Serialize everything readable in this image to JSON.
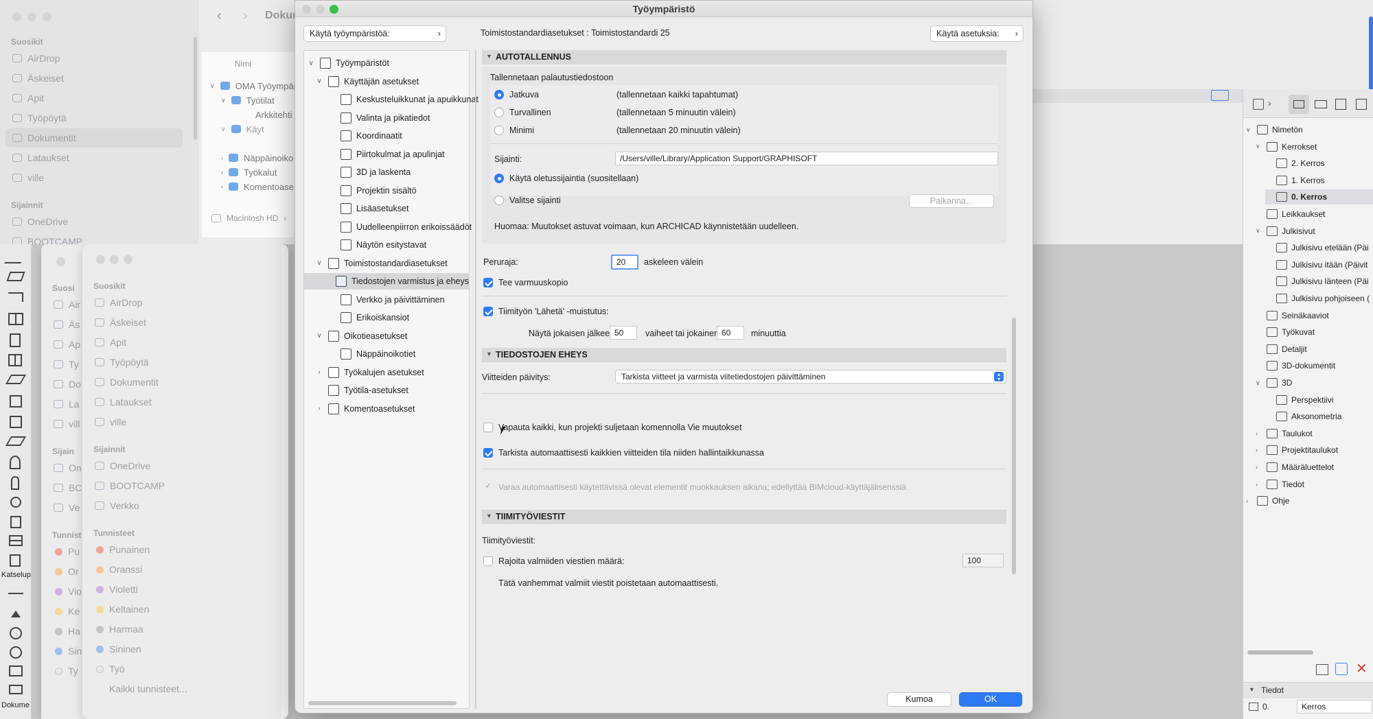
{
  "dialog": {
    "title": "Työympäristö",
    "top_left_button": "Käytä työympäristöä:",
    "breadcrumb": "Toimistostandardiasetukset : Toimistostandardi 25",
    "top_right_button": "Käytä asetuksia:",
    "cancel_label": "Kumoa",
    "ok_label": "OK"
  },
  "tree": [
    {
      "label": "Työympäristöt",
      "icon": "profile-icon"
    },
    {
      "label": "Käyttäjän asetukset",
      "icon": "user-settings-icon"
    },
    {
      "label": "Keskusteluikkunat ja apuikkunat",
      "icon": "dialogs-icon"
    },
    {
      "label": "Valinta ja pikatiedot",
      "icon": "selection-icon"
    },
    {
      "label": "Koordinaatit",
      "icon": "coordinates-icon"
    },
    {
      "label": "Piirtokulmat ja apulinjat",
      "icon": "snap-icon"
    },
    {
      "label": "3D ja laskenta",
      "icon": "3d-icon"
    },
    {
      "label": "Projektin sisältö",
      "icon": "project-icon"
    },
    {
      "label": "Lisäasetukset",
      "icon": "sliders-icon"
    },
    {
      "label": "Uudelleenpiirron erikoissäädöt",
      "icon": "redraw-icon"
    },
    {
      "label": "Näytön esitystavat",
      "icon": "display-icon"
    },
    {
      "label": "Toimistostandardiasetukset",
      "icon": "company-icon"
    },
    {
      "label": "Tiedostojen varmistus ja eheys",
      "icon": "file-safety-icon"
    },
    {
      "label": "Verkko ja päivittäminen",
      "icon": "network-icon"
    },
    {
      "label": "Erikoiskansiot",
      "icon": "folders-icon"
    },
    {
      "label": "Oikotieasetukset",
      "icon": "shortcut-icon"
    },
    {
      "label": "Näppäinoikotiet",
      "icon": "keyboard-icon"
    },
    {
      "label": "Työkalujen asetukset",
      "icon": "tools-icon"
    },
    {
      "label": "Työtila-asetukset",
      "icon": "workspace-icon"
    },
    {
      "label": "Komentoasetukset",
      "icon": "commands-icon"
    }
  ],
  "panel": {
    "autosave": {
      "header": "AUTOTALLENNUS",
      "group_label": "Tallennetaan palautustiedostoon",
      "options": [
        {
          "label": "Jatkuva",
          "desc": "(tallennetaan kaikki tapahtumat)",
          "selected": true
        },
        {
          "label": "Turvallinen",
          "desc": "(tallennetaan 5 minuutin välein)",
          "selected": false
        },
        {
          "label": "Minimi",
          "desc": "(tallennetaan 20 minuutin välein)",
          "selected": false
        }
      ],
      "location_label": "Sijainti:",
      "location_value": "/Users/ville/Library/Application Support/GRAPHISOFT",
      "default_location": "Käytä oletussijaintia (suositellaan)",
      "choose_location": "Valitse sijainti",
      "browse_button": "Paikanna...",
      "note": "Huomaa: Muutokset astuvat voimaan, kun ARCHICAD käynnistetään uudelleen."
    },
    "undo_label": "Peruraja:",
    "undo_value": "20",
    "undo_suffix": "askeleen välein",
    "backup_label": "Tee varmuuskopio",
    "teamwork_send_label": "Tiimityön 'Lähetä' -muistutus:",
    "reminder_prefix": "Näytä jokaisen jälkeen",
    "reminder_steps": "50",
    "reminder_middle": "vaiheet tai jokainen",
    "reminder_minutes": "60",
    "reminder_suffix": "minuuttia",
    "integrity": {
      "header": "TIEDOSTOJEN EHEYS",
      "refs_label": "Viitteiden päivitys:",
      "refs_value": "Tarkista viitteet ja varmista viitetiedostojen päivittäminen",
      "release_all": "Vapauta kaikki, kun projekti suljetaan komennolla Vie muutokset",
      "auto_check": "Tarkista automaattisesti kaikkien viitteiden tila niiden hallintaikkunassa",
      "reserve_auto": "Varaa automaattisesti käytettävissä olevat elementit muokkauksen aikana; edellyttää BIMcloud-käyttäjälisenssiä"
    },
    "teamwork_messages": {
      "header": "TIIMITYÖVIESTIT",
      "label": "Tiimityöviestit:",
      "limit_label": "Rajoita valmiiden viestien määrä:",
      "limit_value": "100",
      "note": "Tätä vanhemmat valmiit viestit poistetaan automaattisesti."
    }
  },
  "finder_back": {
    "title": "Dokum",
    "column_header": "Nimi",
    "favorites_header": "Suosikit",
    "favorites": [
      "AirDrop",
      "Äskeiset",
      "Apit",
      "Työpöytä",
      "Dokumentit",
      "Lataukset",
      "ville"
    ],
    "locations_header": "Sijainnit",
    "locations": [
      "OneDrive",
      "BOOTCAMP"
    ],
    "files": [
      "OMA Työympär",
      "Työtilat",
      "Arkkitehti",
      "Käyt",
      "Näppäinoiko",
      "Työkalut",
      "Komentoase"
    ],
    "path": [
      "Macintosh HD"
    ]
  },
  "finder_front": {
    "favorites_header": "Suosikit",
    "favorites": [
      "AirDrop",
      "Äskeiset",
      "Apit",
      "Työpöytä",
      "Dokumentit",
      "Lataukset",
      "ville"
    ],
    "locations_header": "Sijainnit",
    "locations": [
      "OneDrive",
      "BOOTCAMP",
      "Verkko"
    ],
    "tags_header": "Tunnisteet",
    "tags": [
      {
        "label": "Punainen",
        "color": "#f2a49c"
      },
      {
        "label": "Oranssi",
        "color": "#f5c79a"
      },
      {
        "label": "Violetti",
        "color": "#cfb1e0"
      },
      {
        "label": "Keltainen",
        "color": "#f2dc9a"
      },
      {
        "label": "Harmaa",
        "color": "#c4c4c7"
      },
      {
        "label": "Sininen",
        "color": "#9fc0ef"
      },
      {
        "label": "Työ",
        "color": "#e8e8ea"
      },
      {
        "label": "Kaikki tunnisteet...",
        "color": ""
      }
    ]
  },
  "finder_left": {
    "favorites_header": "Suosi",
    "favorites": [
      "Air",
      "Äs",
      "Ap",
      "Ty",
      "Do",
      "La",
      "vill"
    ],
    "locations_header": "Sijain",
    "locations": [
      "On",
      "BC",
      "Ve"
    ],
    "tags_header": "Tunnist",
    "tags": [
      "Pu",
      "Or",
      "Vio",
      "Ke",
      "Ha",
      "Sin",
      "Ty"
    ]
  },
  "toolbox": {
    "view_label": "Katselup",
    "doc_label": "Dokume"
  },
  "navigator": {
    "items": [
      {
        "label": "Nimetön",
        "icon": "project-icon",
        "level": 0,
        "twisty": "open"
      },
      {
        "label": "Kerrokset",
        "icon": "stories-icon",
        "level": 1,
        "twisty": "open"
      },
      {
        "label": "2. Kerros",
        "icon": "story-icon",
        "level": 2,
        "twisty": ""
      },
      {
        "label": "1. Kerros",
        "icon": "story-icon",
        "level": 2,
        "twisty": ""
      },
      {
        "label": "0. Kerros",
        "icon": "story-icon",
        "level": 2,
        "twisty": "",
        "selected": true
      },
      {
        "label": "Leikkaukset",
        "icon": "section-icon",
        "level": 1,
        "twisty": ""
      },
      {
        "label": "Julkisivut",
        "icon": "elevation-icon",
        "level": 1,
        "twisty": "open"
      },
      {
        "label": "Julkisivu etelään (Päi",
        "icon": "elevation-icon",
        "level": 2,
        "twisty": ""
      },
      {
        "label": "Julkisivu itään (Päivit",
        "icon": "elevation-icon",
        "level": 2,
        "twisty": ""
      },
      {
        "label": "Julkisivu länteen (Päi",
        "icon": "elevation-icon",
        "level": 2,
        "twisty": ""
      },
      {
        "label": "Julkisivu pohjoiseen (",
        "icon": "elevation-icon",
        "level": 2,
        "twisty": ""
      },
      {
        "label": "Seinäkaaviot",
        "icon": "wall-icon",
        "level": 1,
        "twisty": ""
      },
      {
        "label": "Työkuvat",
        "icon": "worksheet-icon",
        "level": 1,
        "twisty": ""
      },
      {
        "label": "Detaljit",
        "icon": "detail-icon",
        "level": 1,
        "twisty": ""
      },
      {
        "label": "3D-dokumentit",
        "icon": "3d-doc-icon",
        "level": 1,
        "twisty": ""
      },
      {
        "label": "3D",
        "icon": "3d-icon",
        "level": 1,
        "twisty": "open"
      },
      {
        "label": "Perspektiivi",
        "icon": "perspective-icon",
        "level": 2,
        "twisty": ""
      },
      {
        "label": "Aksonometria",
        "icon": "axonometry-icon",
        "level": 2,
        "twisty": ""
      },
      {
        "label": "Taulukot",
        "icon": "table-icon",
        "level": 1,
        "twisty": "closed"
      },
      {
        "label": "Projektitaulukot",
        "icon": "list-icon",
        "level": 1,
        "twisty": "closed"
      },
      {
        "label": "Määräluettelot",
        "icon": "list-icon",
        "level": 1,
        "twisty": "closed"
      },
      {
        "label": "Tiedot",
        "icon": "info-icon",
        "level": 1,
        "twisty": "closed"
      },
      {
        "label": "Ohje",
        "icon": "help-icon",
        "level": 0,
        "twisty": "closed"
      }
    ],
    "info_header": "Tiedot",
    "info_story_num": "0.",
    "info_story_name": "Kerros"
  }
}
